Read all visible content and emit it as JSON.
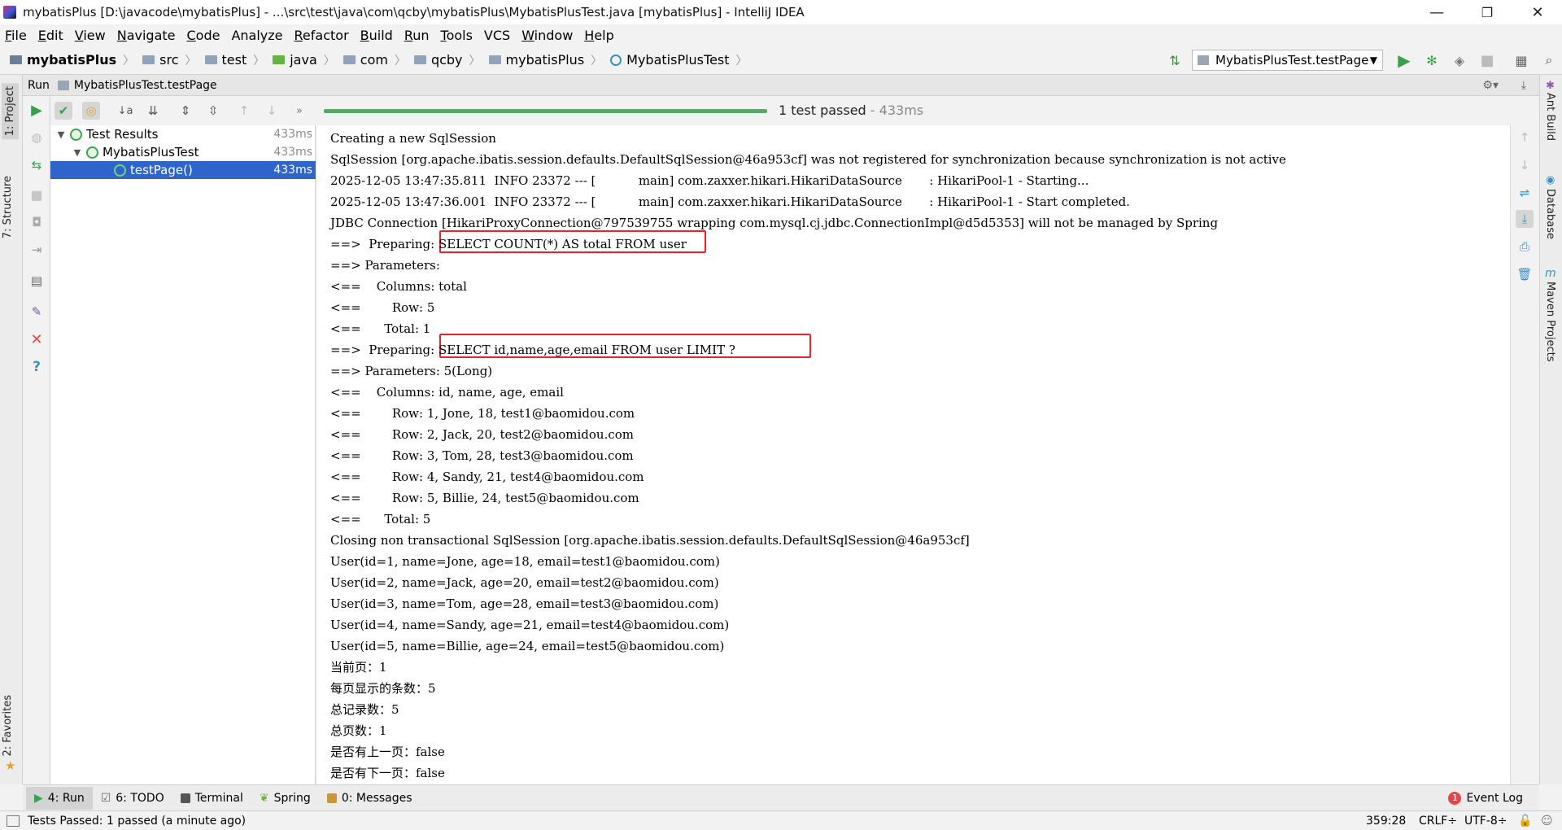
{
  "window": {
    "title": "mybatisPlus [D:\\javacode\\mybatisPlus] - ...\\src\\test\\java\\com\\qcby\\mybatisPlus\\MybatisPlusTest.java [mybatisPlus] - IntelliJ IDEA",
    "controls": {
      "minimize": "—",
      "restore": "❐",
      "close": "✕"
    }
  },
  "menu": [
    {
      "label": "File",
      "mn": "F",
      "rest": "ile"
    },
    {
      "label": "Edit",
      "mn": "E",
      "rest": "dit"
    },
    {
      "label": "View",
      "mn": "V",
      "rest": "iew"
    },
    {
      "label": "Navigate",
      "mn": "N",
      "rest": "avigate"
    },
    {
      "label": "Code",
      "mn": "C",
      "rest": "ode"
    },
    {
      "label": "Analyze",
      "mn": "",
      "rest": "Analyze"
    },
    {
      "label": "Refactor",
      "mn": "R",
      "rest": "efactor"
    },
    {
      "label": "Build",
      "mn": "B",
      "rest": "uild"
    },
    {
      "label": "Run",
      "mn": "R",
      "rest": "un"
    },
    {
      "label": "Tools",
      "mn": "T",
      "rest": "ools"
    },
    {
      "label": "VCS",
      "mn": "",
      "rest": "VCS"
    },
    {
      "label": "Window",
      "mn": "W",
      "rest": "indow"
    },
    {
      "label": "Help",
      "mn": "H",
      "rest": "elp"
    }
  ],
  "breadcrumb": {
    "project": "mybatisPlus",
    "items": [
      "src",
      "test",
      "java",
      "com",
      "qcby",
      "mybatisPlus"
    ],
    "file": "MybatisPlusTest"
  },
  "run_config": {
    "selected": "MybatisPlusTest.testPage"
  },
  "side_tabs": {
    "left": {
      "project": "1: Project",
      "structure": "7: Structure",
      "favorites": "2: Favorites"
    },
    "right": {
      "ant": "Ant Build",
      "database": "Database",
      "maven": "Maven Projects"
    }
  },
  "run_panel": {
    "label": "Run",
    "tab": "MybatisPlusTest.testPage",
    "progress": 1.0,
    "status": "1 test passed",
    "duration": " - 433ms"
  },
  "test_tree": [
    {
      "label": "Test Results",
      "time": "433ms"
    },
    {
      "label": "MybatisPlusTest",
      "time": "433ms"
    },
    {
      "label": "testPage()",
      "time": "433ms"
    }
  ],
  "console_lines": [
    "Creating a new SqlSession",
    "SqlSession [org.apache.ibatis.session.defaults.DefaultSqlSession@46a953cf] was not registered for synchronization because synchronization is not active",
    "2025-12-05 13:47:35.811  INFO 23372 --- [           main] com.zaxxer.hikari.HikariDataSource       : HikariPool-1 - Starting...",
    "2025-12-05 13:47:36.001  INFO 23372 --- [           main] com.zaxxer.hikari.HikariDataSource       : HikariPool-1 - Start completed.",
    "JDBC Connection [HikariProxyConnection@797539755 wrapping com.mysql.cj.jdbc.ConnectionImpl@d5d5353] will not be managed by Spring",
    "==>  Preparing: SELECT COUNT(*) AS total FROM user",
    "==> Parameters: ",
    "<==    Columns: total",
    "<==        Row: 5",
    "<==      Total: 1",
    "==>  Preparing: SELECT id,name,age,email FROM user LIMIT ?",
    "==> Parameters: 5(Long)",
    "<==    Columns: id, name, age, email",
    "<==        Row: 1, Jone, 18, test1@baomidou.com",
    "<==        Row: 2, Jack, 20, test2@baomidou.com",
    "<==        Row: 3, Tom, 28, test3@baomidou.com",
    "<==        Row: 4, Sandy, 21, test4@baomidou.com",
    "<==        Row: 5, Billie, 24, test5@baomidou.com",
    "<==      Total: 5",
    "Closing non transactional SqlSession [org.apache.ibatis.session.defaults.DefaultSqlSession@46a953cf]",
    "User(id=1, name=Jone, age=18, email=test1@baomidou.com)",
    "User(id=2, name=Jack, age=20, email=test2@baomidou.com)",
    "User(id=3, name=Tom, age=28, email=test3@baomidou.com)",
    "User(id=4, name=Sandy, age=21, email=test4@baomidou.com)",
    "User(id=5, name=Billie, age=24, email=test5@baomidou.com)",
    "当前页：1",
    "每页显示的条数：5",
    "总记录数：5",
    "总页数：1",
    "是否有上一页：false",
    "是否有下一页：false"
  ],
  "bottom_tabs": {
    "run": "4: Run",
    "todo": "6: TODO",
    "terminal": "Terminal",
    "spring": "Spring",
    "messages": "0: Messages",
    "event_log": "Event Log",
    "event_count": "1"
  },
  "status_bar": {
    "message": "Tests Passed: 1 passed (a minute ago)",
    "position": "359:28",
    "line_sep": "CRLF÷",
    "encoding": "UTF-8÷"
  },
  "colors": {
    "accent_selected": "#2f65ca",
    "pass_green": "#59a869",
    "highlight_box": "#e3242b"
  }
}
